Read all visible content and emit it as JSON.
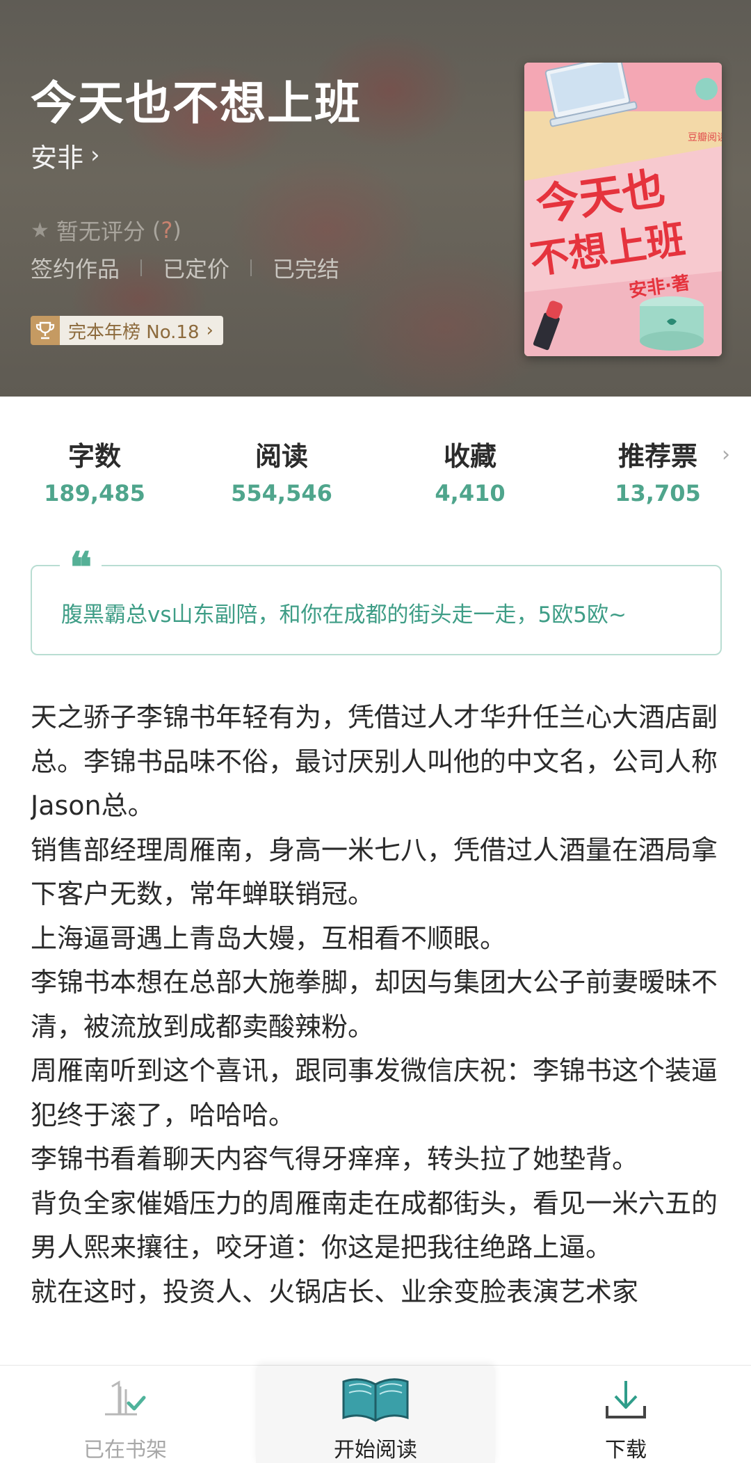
{
  "book": {
    "title": "今天也不想上班",
    "author": "安非",
    "author_chevron": "›",
    "rating_label": "暂无评分",
    "rating_help_open": "(",
    "rating_help_q": "?",
    "rating_help_close": ")",
    "tags": [
      "签约作品",
      "已定价",
      "已完结"
    ],
    "rank_label": "完本年榜 No.18",
    "rank_chevron": "›",
    "cover": {
      "title_line1": "今天也",
      "title_line2": "不想上班",
      "author_sign": "安非·著",
      "publisher": "豆瓣阅读"
    }
  },
  "stats": [
    {
      "label": "字数",
      "value": "189,485"
    },
    {
      "label": "阅读",
      "value": "554,546"
    },
    {
      "label": "收藏",
      "value": "4,410"
    },
    {
      "label": "推荐票",
      "value": "13,705",
      "chevron": "›"
    }
  ],
  "quote": {
    "mark": "❝",
    "text": "腹黑霸总vs山东副陪，和你在成都的街头走一走，5欧5欧~"
  },
  "synopsis": [
    "天之骄子李锦书年轻有为，凭借过人才华升任兰心大酒店副总。李锦书品味不俗，最讨厌别人叫他的中文名，公司人称Jason总。",
    "销售部经理周雁南，身高一米七八，凭借过人酒量在酒局拿下客户无数，常年蝉联销冠。",
    "上海逼哥遇上青岛大嫚，互相看不顺眼。",
    "李锦书本想在总部大施拳脚，却因与集团大公子前妻暧昧不清，被流放到成都卖酸辣粉。",
    "周雁南听到这个喜讯，跟同事发微信庆祝：李锦书这个装逼犯终于滚了，哈哈哈。",
    "李锦书看着聊天内容气得牙痒痒，转头拉了她垫背。",
    "背负全家催婚压力的周雁南走在成都街头，看见一米六五的男人熙来攘往，咬牙道：你这是把我往绝路上逼。",
    "就在这时，投资人、火锅店长、业余变脸表演艺术家"
  ],
  "bottom_bar": {
    "shelf_label": "已在书架",
    "read_label": "开始阅读",
    "download_label": "下载"
  },
  "colors": {
    "accent_green": "#4fa58c",
    "rank_gold": "#c59a62",
    "header_bg": "#615e57"
  }
}
